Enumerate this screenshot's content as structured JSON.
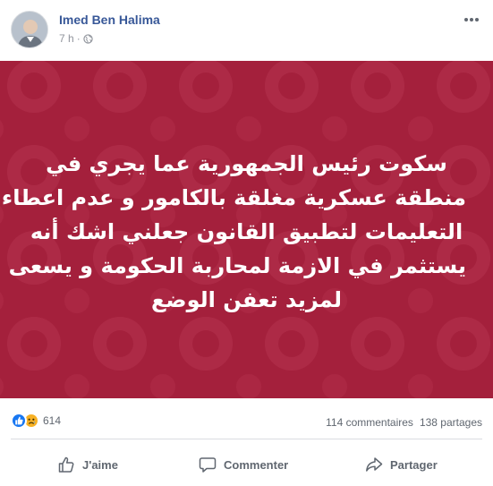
{
  "post": {
    "author": "Imed Ben Halima",
    "time": "7 h",
    "separator": "·",
    "text_lines": [
      "سكوت رئيس الجمهورية عما يجري في",
      "منطقة عسكرية مغلقة بالكامور و عدم اعطاء",
      "التعليمات لتطبيق القانون جعلني اشك أنه",
      "يستثمر في الازمة لمحاربة الحكومة و يسعى",
      "لمزيد تعفن الوضع"
    ],
    "banner_color": "#a4203c"
  },
  "stats": {
    "reaction_count": "614",
    "comments": "114 commentaires",
    "shares": "138 partages"
  },
  "actions": {
    "like": "J'aime",
    "comment": "Commenter",
    "share": "Partager"
  },
  "icons": {
    "privacy": "globe-icon",
    "menu": "more-options-icon",
    "reactions": [
      "like-reaction-icon",
      "sad-reaction-icon"
    ],
    "like": "thumbs-up-icon",
    "comment": "comment-bubble-icon",
    "share": "share-arrow-icon"
  },
  "colors": {
    "author_link": "#385898",
    "secondary_text": "#606770",
    "like_blue": "#1877f2"
  }
}
